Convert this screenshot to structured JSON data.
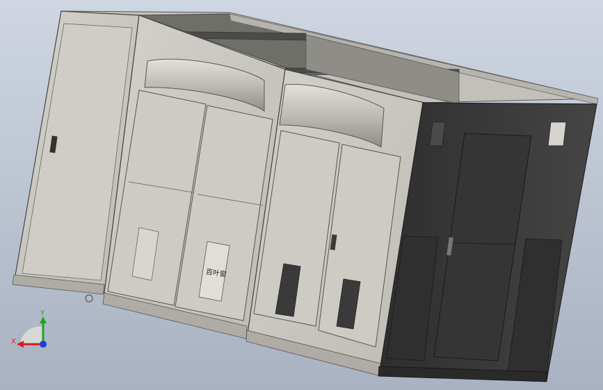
{
  "viewport": {
    "background_top": "#cfd6e2",
    "background_bottom": "#a9b2c2"
  },
  "model": {
    "body_color": "#c9c7c0",
    "dark_section_color": "#3b3b3b",
    "door_plate_text": "百叶窗"
  },
  "triad": {
    "x_label": "X",
    "y_label": "Y",
    "x_color": "#d81b1b",
    "y_color": "#1fa31f",
    "z_color": "#1b3fd8"
  }
}
